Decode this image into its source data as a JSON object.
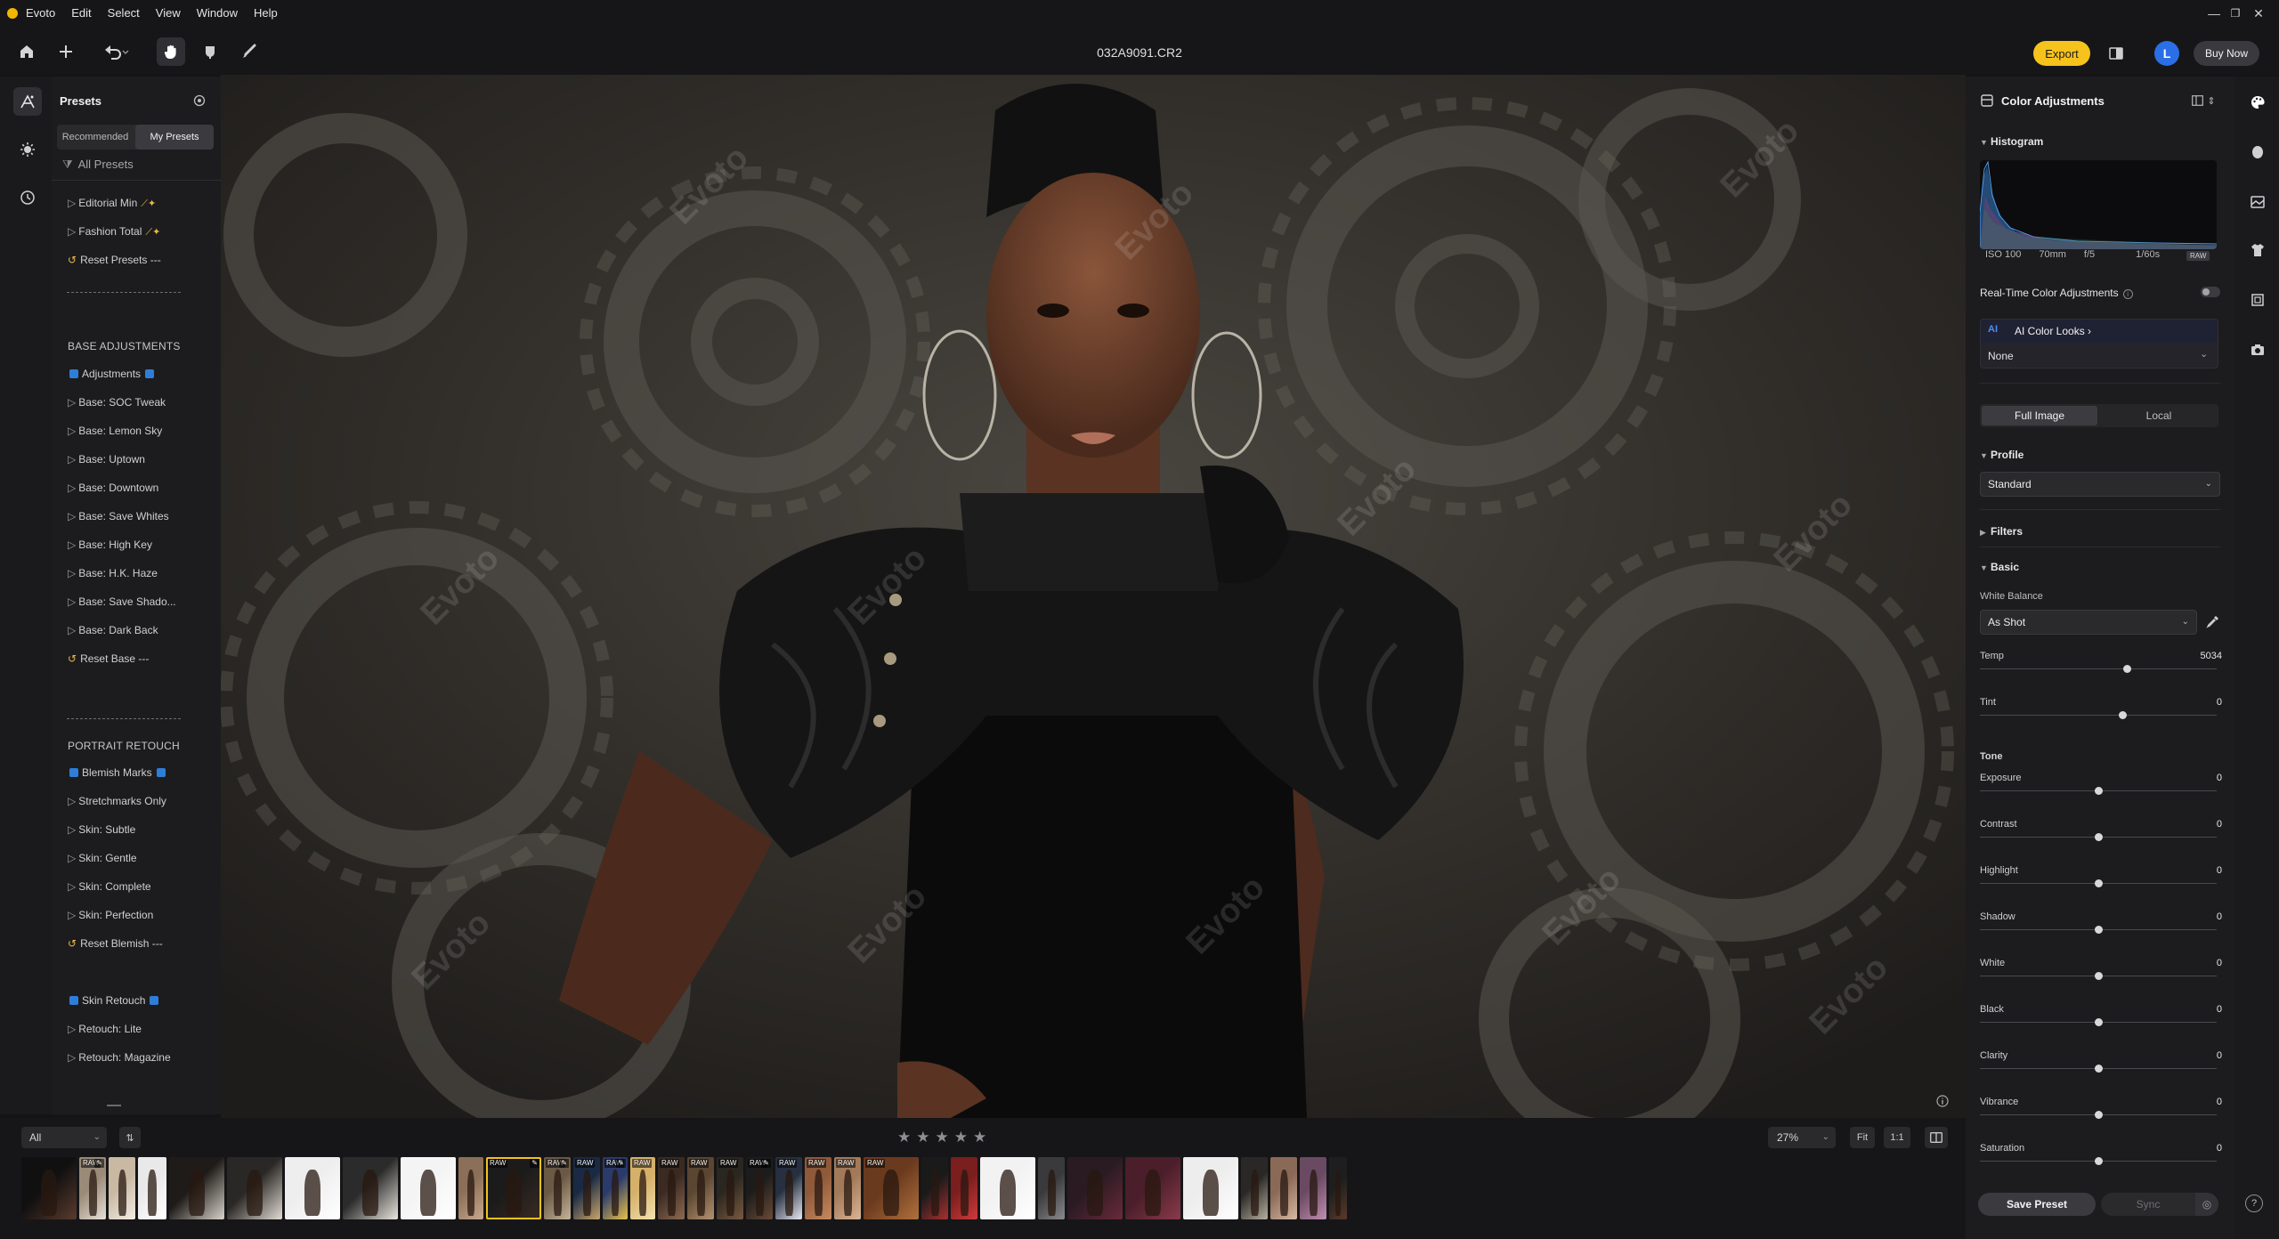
{
  "app": {
    "name": "Evoto",
    "file_title": "032A9091.CR2"
  },
  "menu": [
    "Evoto",
    "Edit",
    "Select",
    "View",
    "Window",
    "Help"
  ],
  "window_controls": {
    "minimize": "—",
    "restore": "❐",
    "close": "✕"
  },
  "toolbar": {
    "export_label": "Export",
    "avatar_letter": "L",
    "buy_now_label": "Buy Now"
  },
  "presets_panel": {
    "title": "Presets",
    "tabs": [
      "Recommended",
      "My Presets"
    ],
    "active_tab": "My Presets",
    "all_presets_label": "All Presets",
    "top_items": [
      "Editorial Min",
      "Fashion Total",
      "Reset Presets ---"
    ],
    "base_section": "BASE ADJUSTMENTS",
    "base_items": [
      "Adjustments",
      "Base: SOC Tweak",
      "Base: Lemon Sky",
      "Base: Uptown",
      "Base: Downtown",
      "Base: Save Whites",
      "Base: High Key",
      "Base: H.K. Haze",
      "Base: Save Shado...",
      "Base: Dark Back",
      "Reset Base ---"
    ],
    "portrait_section": "PORTRAIT RETOUCH",
    "portrait_items": [
      "Blemish Marks",
      "Stretchmarks Only",
      "Skin: Subtle",
      "Skin: Gentle",
      "Skin: Complete",
      "Skin: Perfection",
      "Reset Blemish ---"
    ],
    "retouch_items": [
      "Skin Retouch",
      "Retouch: Lite",
      "Retouch: Magazine"
    ]
  },
  "canvas": {
    "watermark": "Evoto"
  },
  "filmstrip": {
    "filter_value": "All",
    "sort_label": "⇅",
    "rating_stars": [
      "★",
      "★",
      "★",
      "★",
      "★"
    ],
    "zoom_value": "27%",
    "fit_label": "Fit",
    "one_to_one_label": "1:1",
    "raw_badge": "RAW",
    "thumbnails_count_visible": 42
  },
  "color_adjustments": {
    "title": "Color Adjustments",
    "histogram_label": "Histogram",
    "exif": {
      "iso": "ISO 100",
      "focal": "70mm",
      "aperture": "f/5",
      "shutter": "1/60s",
      "format": "RAW"
    },
    "realtime_label": "Real-Time Color Adjustments",
    "realtime_on": false,
    "ai_looks_label": "AI Color Looks",
    "ai_badge": "AI",
    "ai_looks_value": "None",
    "scope_tabs": [
      "Full Image",
      "Local"
    ],
    "active_scope": "Full Image",
    "profile_label": "Profile",
    "profile_value": "Standard",
    "filters_label": "Filters",
    "basic_label": "Basic",
    "white_balance_label": "White Balance",
    "white_balance_value": "As Shot",
    "tone_label": "Tone",
    "sliders": [
      {
        "label": "Temp",
        "value": "5034",
        "position": 0.62
      },
      {
        "label": "Tint",
        "value": "0",
        "position": 0.6
      },
      {
        "label": "Exposure",
        "value": "0",
        "position": 0.5
      },
      {
        "label": "Contrast",
        "value": "0",
        "position": 0.5
      },
      {
        "label": "Highlight",
        "value": "0",
        "position": 0.5
      },
      {
        "label": "Shadow",
        "value": "0",
        "position": 0.5
      },
      {
        "label": "White",
        "value": "0",
        "position": 0.5
      },
      {
        "label": "Black",
        "value": "0",
        "position": 0.5
      },
      {
        "label": "Clarity",
        "value": "0",
        "position": 0.5
      },
      {
        "label": "Vibrance",
        "value": "0",
        "position": 0.5
      },
      {
        "label": "Saturation",
        "value": "0",
        "position": 0.5
      }
    ],
    "save_preset_label": "Save Preset",
    "sync_label": "Sync"
  },
  "colors": {
    "accent": "#f6c21c",
    "blue": "#2b6fe6",
    "panel": "#1c1c1e"
  }
}
